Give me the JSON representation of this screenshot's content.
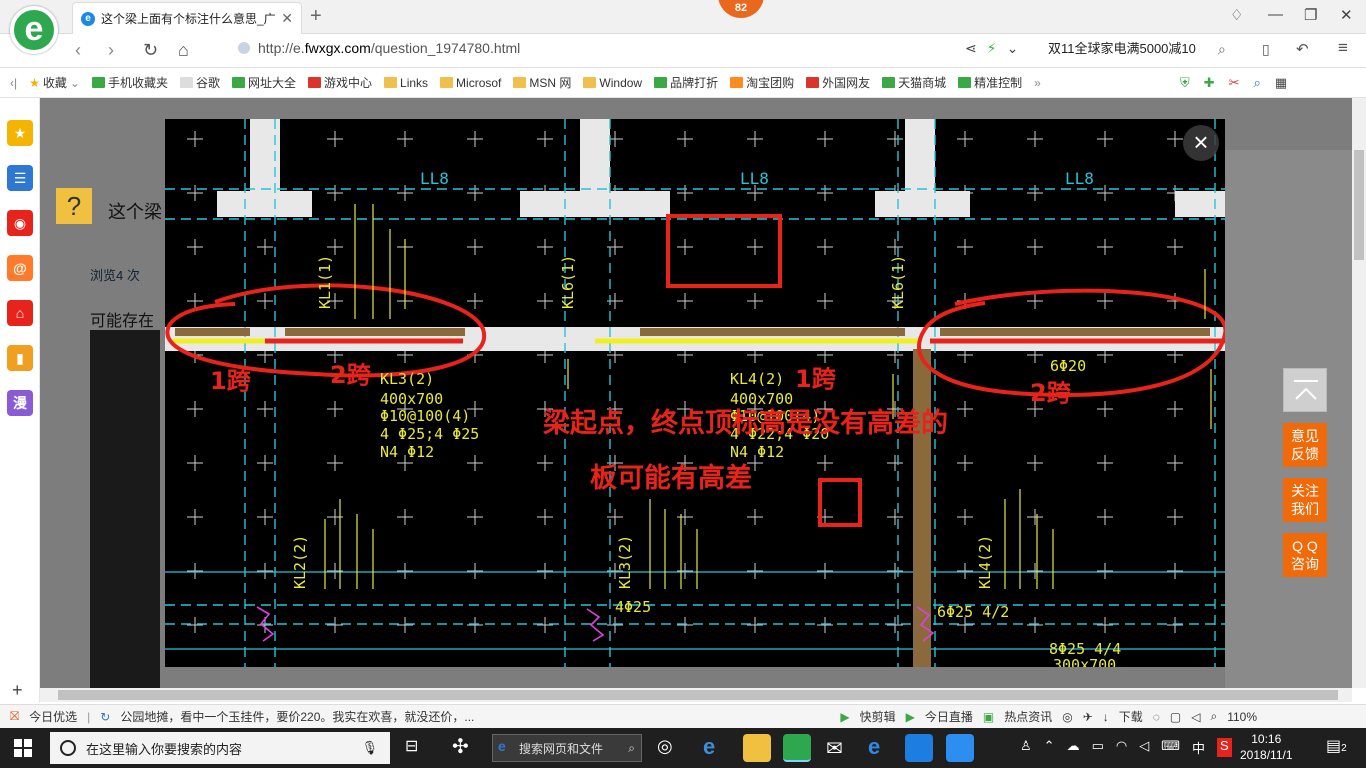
{
  "browser": {
    "tab_title": "这个梁上面有个标注什么意思_广",
    "tab_icon": "e",
    "badge_count": "82",
    "url_prefix": "http://e.",
    "url_domain": "fwxgx.com",
    "url_path": "/question_1974780.html",
    "search_text": "双11全球家电满5000减10"
  },
  "bookmarks": [
    {
      "label": "收藏",
      "icon": "star-icon"
    },
    {
      "label": "手机收藏夹",
      "icon": "phone-icon"
    },
    {
      "label": "谷歌",
      "icon": "page-icon"
    },
    {
      "label": "网址大全",
      "icon": "globe-icon"
    },
    {
      "label": "游戏中心",
      "icon": "game-icon"
    },
    {
      "label": "Links",
      "icon": "folder-icon"
    },
    {
      "label": "Microsof",
      "icon": "folder-icon"
    },
    {
      "label": "MSN 网",
      "icon": "folder-icon"
    },
    {
      "label": "Window",
      "icon": "folder-icon"
    },
    {
      "label": "品牌打折",
      "icon": "leaf-icon"
    },
    {
      "label": "淘宝团购",
      "icon": "taobao-icon"
    },
    {
      "label": "外国网友",
      "icon": "flag-icon"
    },
    {
      "label": "天猫商城",
      "icon": "leaf-icon"
    },
    {
      "label": "精准控制",
      "icon": "wechat-icon"
    }
  ],
  "page": {
    "title_fragment": "这个梁",
    "views": "浏览4 次",
    "answer_fragment": "可能存在"
  },
  "cad": {
    "labels_top": [
      "LL8",
      "LL8",
      "LL8"
    ],
    "span_labels": [
      "1跨",
      "2跨",
      "1跨",
      "2跨"
    ],
    "note_line1": "梁起点，终点顶标高是没有高差的",
    "note_line2": "板可能有高差",
    "beam_kl4": [
      "KL4(2)",
      "400x700",
      "Φ10@100(4)",
      "4 Φ22;4 Φ20",
      "N4 Φ12"
    ],
    "beam_kl3a": [
      "KL3(2)",
      "400x700",
      "Φ10@100(4)",
      "4 Φ25;4 Φ25",
      "N4 Φ12"
    ],
    "rebar_6phi20": "6Φ20",
    "rebar_4phi25": "4Φ25",
    "rebar_6phi25": "6Φ25 4/2",
    "rebar_8phi25": "8Φ25 4/4",
    "rebar_300x700": "300x700",
    "vertical_kl1": "KL1(1)",
    "vertical_kl6a": "KL6(1)",
    "vertical_kl6b": "KL6(1)",
    "vertical_kl2": "KL2(2)",
    "vertical_kl3": "KL3(2)",
    "vertical_kl4": "KL4(2)"
  },
  "floating": {
    "feedback": [
      "意见",
      "反馈"
    ],
    "follow": [
      "关注",
      "我们"
    ],
    "qq": [
      "Q Q",
      "咨询"
    ]
  },
  "statusbar": {
    "today": "今日优选",
    "news": "公园地摊，看中一个玉挂件，要价220。我实在欢喜，就没还价，...",
    "items": [
      "快剪辑",
      "今日直播",
      "热点资讯",
      "下载"
    ],
    "zoom": "110%"
  },
  "taskbar": {
    "cortana_placeholder": "在这里输入你要搜索的内容",
    "search_box": "搜索网页和文件",
    "ime": "中",
    "time": "10:16",
    "date": "2018/11/1",
    "notifications": "2"
  },
  "colors": {
    "accent_orange": "#f06a0a",
    "cad_yellow": "#e8e83a",
    "annotation_red": "#e8231c"
  }
}
